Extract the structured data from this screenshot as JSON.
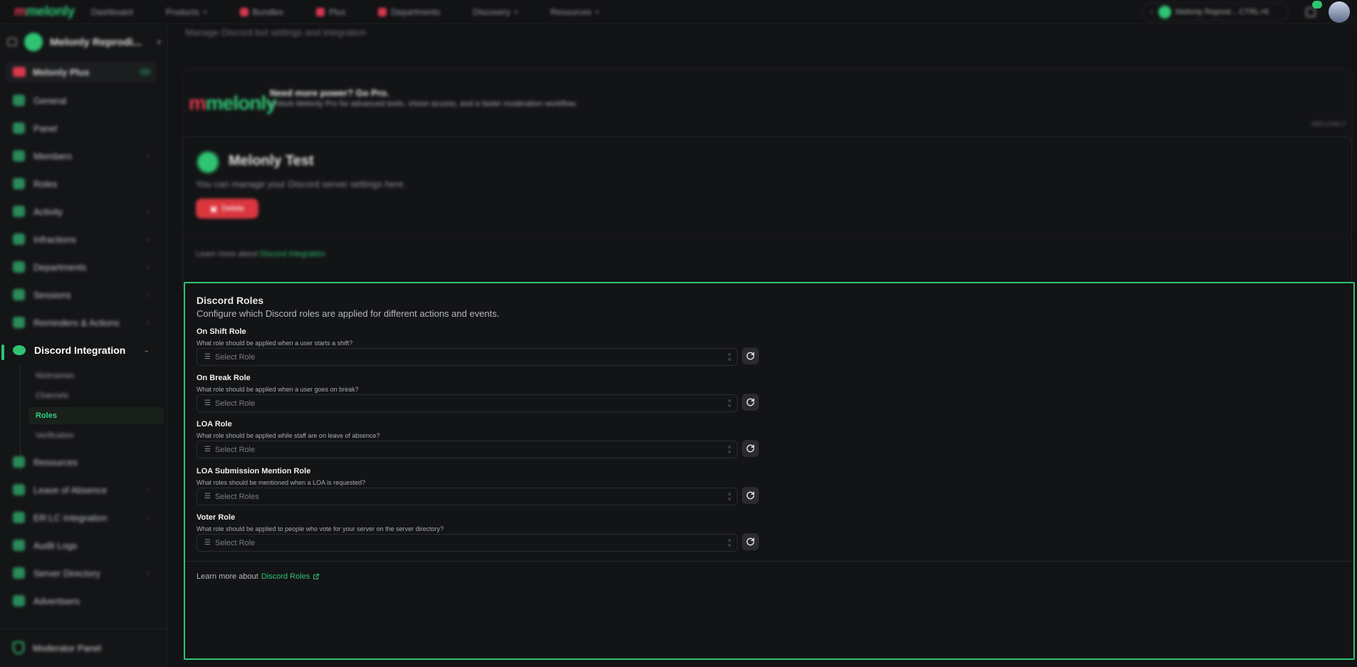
{
  "topnav": {
    "logo": "melonly",
    "links": [
      {
        "label": "Dashboard",
        "has_caret": false
      },
      {
        "label": "Products",
        "has_caret": true
      },
      {
        "label": "Bundles",
        "has_caret": false
      },
      {
        "label": "Plus",
        "has_caret": false
      },
      {
        "label": "Departments",
        "has_caret": false
      },
      {
        "label": "Discovery",
        "has_caret": true
      },
      {
        "label": "Resources",
        "has_caret": true
      }
    ],
    "server_switcher": "Melonly Reprod... CTRL+K",
    "accent_color": "#2fc472"
  },
  "sidebar": {
    "server_name": "Melonly Reprodi...",
    "plus_label": "Melonly Plus",
    "items": [
      {
        "label": "General",
        "icon": "gear-icon",
        "has_chevron": false
      },
      {
        "label": "Panel",
        "icon": "monitor-icon",
        "has_chevron": false
      },
      {
        "label": "Members",
        "icon": "users-icon",
        "has_chevron": true
      },
      {
        "label": "Roles",
        "icon": "key-icon",
        "has_chevron": false
      },
      {
        "label": "Activity",
        "icon": "activity-icon",
        "has_chevron": true
      },
      {
        "label": "Infractions",
        "icon": "gavel-icon",
        "has_chevron": true
      },
      {
        "label": "Departments",
        "icon": "building-icon",
        "has_chevron": true
      },
      {
        "label": "Sessions",
        "icon": "chart-icon",
        "has_chevron": true
      },
      {
        "label": "Reminders & Actions",
        "icon": "shield-icon",
        "has_chevron": true
      },
      {
        "label": "Discord Integration",
        "icon": "discord-icon",
        "has_chevron": true,
        "active": true
      }
    ],
    "sub_items": [
      {
        "label": "Nicknames",
        "active": false
      },
      {
        "label": "Channels",
        "active": false
      },
      {
        "label": "Roles",
        "active": true
      },
      {
        "label": "Verification",
        "active": false
      }
    ],
    "items_after": [
      {
        "label": "Resources",
        "icon": "file-icon",
        "has_chevron": false
      },
      {
        "label": "Leave of Absence",
        "icon": "calendar-icon",
        "has_chevron": true
      },
      {
        "label": "ER:LC Integration",
        "icon": "pencil-icon",
        "has_chevron": true
      },
      {
        "label": "Audit Logs",
        "icon": "history-icon",
        "has_chevron": false
      },
      {
        "label": "Server Directory",
        "icon": "globe-icon",
        "has_chevron": true
      },
      {
        "label": "Advertisers",
        "icon": "megaphone-icon",
        "has_chevron": false
      }
    ],
    "moderator_panel": "Moderator Panel"
  },
  "main": {
    "top_subtitle": "Manage Discord bot settings and integration",
    "promo": {
      "logo": "melonly",
      "title": "Need more power? Go Pro.",
      "text": "Unlock Melonly Pro for advanced tools, Vision access, and a faster moderation workflow.",
      "corner": "MELONLY"
    },
    "server_card": {
      "name": "Melonly Test",
      "description": "You can manage your Discord server settings here.",
      "button": "Delete",
      "learn_prefix": "Learn more about",
      "learn_link": "Discord Integration"
    },
    "roles_card": {
      "title": "Discord Roles",
      "description": "Configure which Discord roles are applied for different actions and events.",
      "fields": [
        {
          "label": "On Shift Role",
          "help": "What role should be applied when a user starts a shift?",
          "placeholder": "Select Role"
        },
        {
          "label": "On Break Role",
          "help": "What role should be applied when a user goes on break?",
          "placeholder": "Select Role"
        },
        {
          "label": "LOA Role",
          "help": "What role should be applied while staff are on leave of absence?",
          "placeholder": "Select Role"
        },
        {
          "label": "LOA Submission Mention Role",
          "help": "What roles should be mentioned when a LOA is requested?",
          "placeholder": "Select Roles"
        },
        {
          "label": "Voter Role",
          "help": "What role should be applied to people who vote for your server on the server directory?",
          "placeholder": "Select Role"
        }
      ],
      "learn_prefix": "Learn more about",
      "learn_link": "Discord Roles"
    }
  }
}
